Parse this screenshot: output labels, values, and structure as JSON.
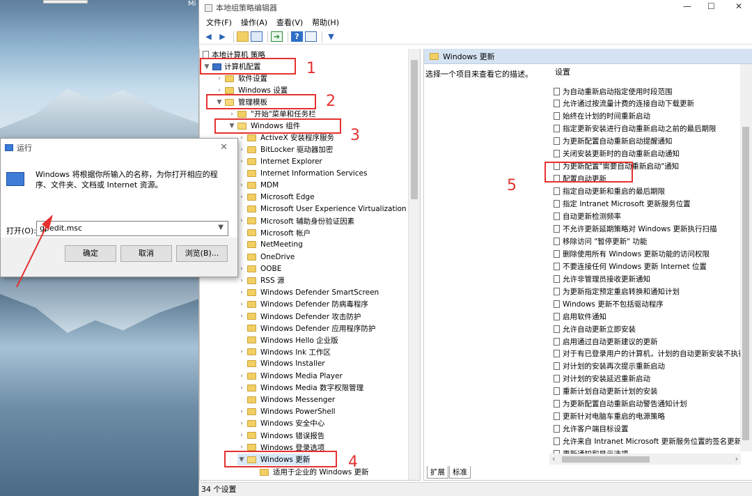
{
  "desktop": {
    "top_label": "Mi"
  },
  "run_dialog": {
    "title": "运行",
    "description": "Windows 将根据你所输入的名称，为你打开相应的程序、文件夹、文档或 Internet 资源。",
    "open_label": "打开(O):",
    "input_value": "gpedit.msc",
    "ok_label": "确定",
    "cancel_label": "取消",
    "browse_label": "浏览(B)..."
  },
  "window": {
    "title": "本地组策略编辑器",
    "menu": [
      "文件(F)",
      "操作(A)",
      "查看(V)",
      "帮助(H)"
    ],
    "status": "34 个设置"
  },
  "tree": {
    "root": "本地计算机 策略",
    "computer_config": "计算机配置",
    "software": "软件设置",
    "windows_settings": "Windows 设置",
    "admin_templates": "管理模板",
    "start_menu": "\"开始\"菜单和任务栏",
    "windows_components": "Windows 组件",
    "components": [
      "ActiveX 安装程序服务",
      "BitLocker 驱动器加密",
      "Internet Explorer",
      "Internet Information Services",
      "MDM",
      "Microsoft Edge",
      "Microsoft User Experience Virtualization",
      "Microsoft 辅助身份验证因素",
      "Microsoft 帐户",
      "NetMeeting",
      "OneDrive",
      "OOBE",
      "RSS 源",
      "Windows Defender SmartScreen",
      "Windows Defender 防病毒程序",
      "Windows Defender 攻击防护",
      "Windows Defender 应用程序防护",
      "Windows Hello 企业版",
      "Windows Ink 工作区",
      "Windows Installer",
      "Windows Media Player",
      "Windows Media 数字权限管理",
      "Windows Messenger",
      "Windows PowerShell",
      "Windows 安全中心",
      "Windows 错误报告",
      "Windows 登录选项"
    ],
    "windows_update": "Windows 更新",
    "wu_child": "适用于企业的 Windows 更新"
  },
  "right_pane": {
    "header": "Windows 更新",
    "description": "选择一个项目来查看它的描述。",
    "column": "设置",
    "settings": [
      "为自动重新启动指定使用时段范围",
      "允许通过按流量计费的连接自动下载更新",
      "始终在计划的时间重新启动",
      "指定更新安装进行自动重新启动之前的最后期限",
      "为更新配置自动重新启动提醒通知",
      "关闭安装更新时的自动重新启动通知",
      "为更新配置\"需要自动重新启动\"通知",
      "配置自动更新",
      "指定自动更新和重启的最后期限",
      "指定 Intranet Microsoft 更新服务位置",
      "自动更新检测频率",
      "不允许更新延期策略对 Windows 更新执行扫描",
      "移除访问 \"暂停更新\" 功能",
      "删除使用所有 Windows 更新功能的访问权限",
      "不要连接任何 Windows 更新 Internet 位置",
      "允许非管理员接收更新通知",
      "为更新指定预定重启转换和通知计划",
      "Windows 更新不包括驱动程序",
      "启用软件通知",
      "允许自动更新立即安装",
      "启用通过自动更新建议的更新",
      "对于有已登录用户的计算机，计划的自动更新安装不执行",
      "对计划的安装再次提示重新启动",
      "对计划的安装延迟重新启动",
      "重新计划自动更新计划的安装",
      "为更新配置自动重新启动警告通知计划",
      "更新针对电脑车重启的电源策略",
      "允许客户端目标设置",
      "允许来自 Intranet Microsoft 更新服务位置的签名更新",
      "更新通知和显示选项"
    ],
    "tabs": [
      "扩展",
      "标准"
    ]
  },
  "annotations": [
    "1",
    "2",
    "3",
    "4",
    "5"
  ],
  "colors": {
    "annotation": "#e5302f",
    "header_bg": "#d5e3f2"
  }
}
